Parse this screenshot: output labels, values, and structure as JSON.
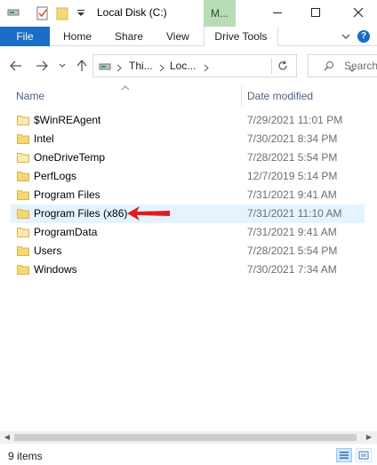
{
  "titlebar": {
    "title": "Local Disk (C:)",
    "manage_tab": "M...",
    "minimize": "—",
    "maximize": "☐",
    "close": "✕"
  },
  "ribbon": {
    "file": "File",
    "home": "Home",
    "share": "Share",
    "view": "View",
    "drive_tools": "Drive Tools",
    "expand": "⌄",
    "help": "?"
  },
  "nav": {
    "crumbs": [
      "Thi...",
      "Loc..."
    ],
    "search_placeholder": "Search"
  },
  "columns": {
    "name": "Name",
    "date_modified": "Date modified"
  },
  "files": [
    {
      "name": "$WinREAgent",
      "date": "7/29/2021 11:01 PM"
    },
    {
      "name": "Intel",
      "date": "7/30/2021 8:34 PM"
    },
    {
      "name": "OneDriveTemp",
      "date": "7/28/2021 5:54 PM"
    },
    {
      "name": "PerfLogs",
      "date": "12/7/2019 5:14 PM"
    },
    {
      "name": "Program Files",
      "date": "7/31/2021 9:41 AM"
    },
    {
      "name": "Program Files (x86)",
      "date": "7/31/2021 11:10 AM"
    },
    {
      "name": "ProgramData",
      "date": "7/31/2021 9:41 AM"
    },
    {
      "name": "Users",
      "date": "7/28/2021 5:54 PM"
    },
    {
      "name": "Windows",
      "date": "7/30/2021 7:34 AM"
    }
  ],
  "status": {
    "item_count": "9 items"
  },
  "colors": {
    "file_tab": "#1a6dc7",
    "manage_tab": "#b7dcb6",
    "selected_row": "#e5f3ff",
    "folder": "#f6d776",
    "annotation_arrow": "#e21b1b",
    "header_text": "#4d6082"
  }
}
